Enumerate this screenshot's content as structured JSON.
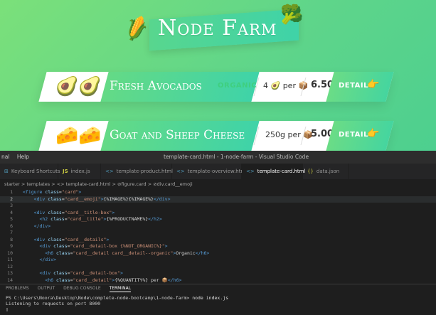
{
  "app": {
    "title": "Node Farm",
    "title_emoji_left": "🌽",
    "title_emoji_right": "🥦",
    "cards": [
      {
        "emoji": "🥑🥑",
        "name": "Fresh Avocados",
        "organic": "ORGANIC",
        "quantity": "4 🥑 per 📦",
        "price": "6.50",
        "detail": "DETAIL",
        "detail_icon": "👉"
      },
      {
        "emoji": "🧀🧀",
        "name": "Goat and Sheep Cheese",
        "organic": "",
        "quantity": "250g per 📦",
        "price": "5.00",
        "detail": "DETAIL",
        "detail_icon": "👉"
      }
    ]
  },
  "vscode": {
    "menu": [
      "nal",
      "Help"
    ],
    "window_title": "template-card.html - 1-node-farm - Visual Studio Code",
    "tabs": [
      {
        "icon": "⊞",
        "label": "Keyboard Shortcuts"
      },
      {
        "icon": "JS",
        "label": "index.js"
      },
      {
        "icon": "<>",
        "label": "template-product.html"
      },
      {
        "icon": "<>",
        "label": "template-overview.html"
      },
      {
        "icon": "<>",
        "label": "template-card.html"
      },
      {
        "icon": "{}",
        "label": "data.json"
      }
    ],
    "breadcrumb": "starter > templates > <> template-card.html > ⊘figure.card > ⊘div.card__emoji",
    "code_lines": [
      {
        "n": "1",
        "t": "<figure class=\"card\">"
      },
      {
        "n": "2",
        "t": "    <div class=\"card__emoji\">{%IMAGE%}{%IMAGE%}</div>"
      },
      {
        "n": "3",
        "t": ""
      },
      {
        "n": "4",
        "t": "    <div class=\"card__title-box\">"
      },
      {
        "n": "5",
        "t": "      <h2 class=\"card__title\">{%PRODUCTNAME%}</h2>"
      },
      {
        "n": "6",
        "t": "    </div>"
      },
      {
        "n": "7",
        "t": ""
      },
      {
        "n": "8",
        "t": "    <div class=\"card__details\">"
      },
      {
        "n": "9",
        "t": "      <div class=\"card__detail-box {%NOT_ORGANIC%}\">"
      },
      {
        "n": "10",
        "t": "        <h6 class=\"card__detail card__detail--organic\">Organic</h6>"
      },
      {
        "n": "11",
        "t": "      </div>"
      },
      {
        "n": "12",
        "t": ""
      },
      {
        "n": "13",
        "t": "      <div class=\"card__detail-box\">"
      },
      {
        "n": "14",
        "t": "        <h6 class=\"card__detail\">{%QUANTITY%} per 📦</h6>"
      }
    ],
    "panel_tabs": [
      "PROBLEMS",
      "OUTPUT",
      "DEBUG CONSOLE",
      "TERMINAL"
    ],
    "terminal": {
      "prompt": "PS C:\\Users\\Noora\\Desktop\\Node\\complete-node-bootcamp\\1-node-farm>",
      "command": " node index.js",
      "output": "Listening to requests on port 8000",
      "cursor": "▯"
    }
  }
}
